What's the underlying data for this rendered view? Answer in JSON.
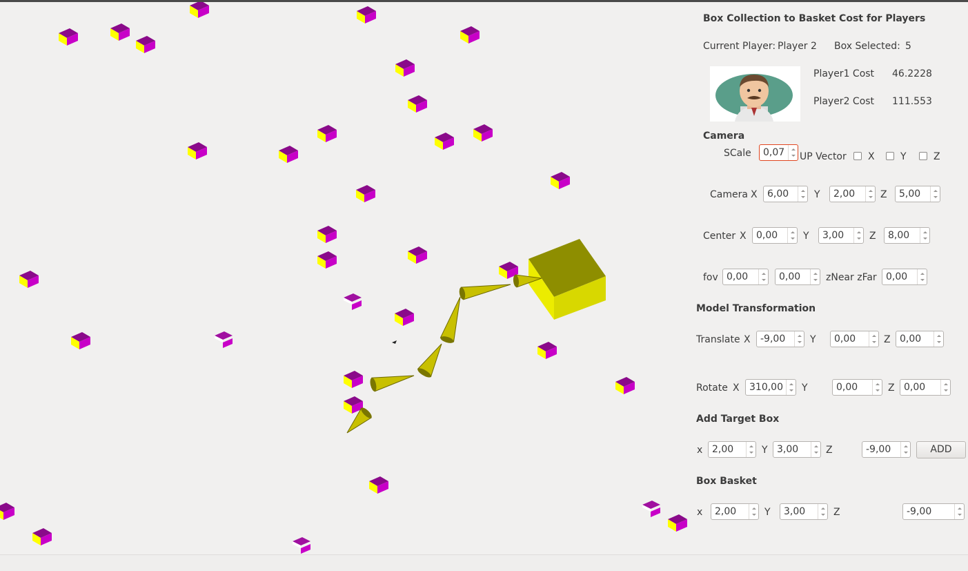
{
  "title": "Box Collection to Basket Cost for Players",
  "status": {
    "current_player_label": "Current Player:",
    "current_player_value": "Player 2",
    "box_selected_label": "Box Selected:",
    "box_selected_value": "5"
  },
  "costs": {
    "player1_label": "Player1 Cost",
    "player1_value": "46.2228",
    "player2_label": "Player2 Cost",
    "player2_value": "111.553"
  },
  "camera": {
    "heading": "Camera",
    "scale_label": "SCale",
    "scale_value": "0,07",
    "up_vector_label": "UP Vector",
    "up_x_label": "X",
    "up_y_label": "Y",
    "up_z_label": "Z",
    "camera_label": "Camera",
    "cam_x_label": "X",
    "cam_x": "6,00",
    "cam_y_label": "Y",
    "cam_y": "2,00",
    "cam_z_label": "Z",
    "cam_z": "5,00",
    "center_label": "Center",
    "ctr_x_label": "X",
    "ctr_x": "0,00",
    "ctr_y_label": "Y",
    "ctr_y": "3,00",
    "ctr_z_label": "Z",
    "ctr_z": "8,00",
    "fov_label": "fov",
    "fov_1": "0,00",
    "fov_2": "0,00",
    "znear_zfar_label": "zNear  zFar",
    "zfar": "0,00"
  },
  "model": {
    "heading": "Model Transformation",
    "translate_label": "Translate",
    "tr_x_label": "X",
    "tr_x": "-9,00",
    "tr_y_label": "Y",
    "tr_y": "0,00",
    "tr_z_label": "Z",
    "tr_z": "0,00",
    "rotate_label": "Rotate",
    "rot_x_label": "X",
    "rot_x": "310,00",
    "rot_y_label": "Y",
    "rot_y": "0,00",
    "rot_z_label": "Z",
    "rot_z": "0,00"
  },
  "target": {
    "heading": "Add Target Box",
    "x_label": "x",
    "x": "2,00",
    "y_label": "Y",
    "y": "3,00",
    "z_label": "Z",
    "z": "-9,00",
    "add_label": "ADD"
  },
  "basket": {
    "heading": "Box Basket",
    "x_label": "x",
    "x": "2,00",
    "y_label": "Y",
    "y": "3,00",
    "z_label": "Z",
    "z": "-9,00"
  },
  "colors": {
    "background": "#f1f0ef",
    "box_magenta": "#c800c8",
    "box_yellow": "#ffff00",
    "basket_yellow": "#d8d800",
    "focus_border": "#e0461f"
  }
}
